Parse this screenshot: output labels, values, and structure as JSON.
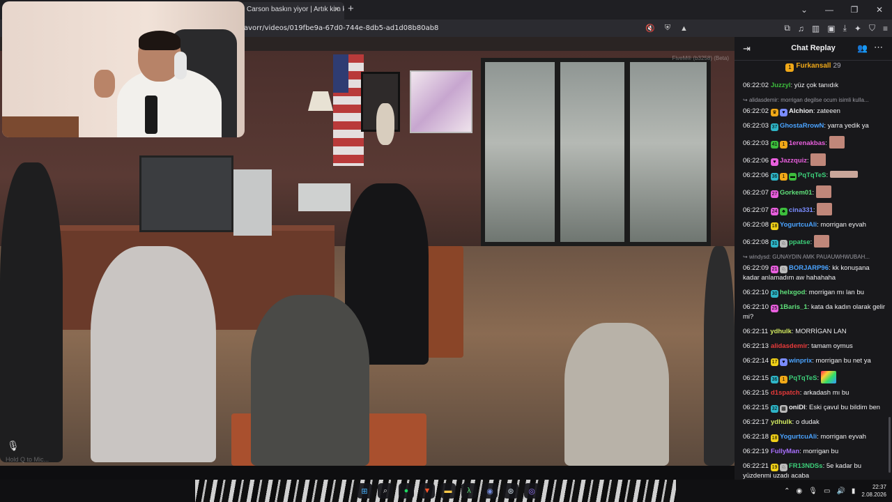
{
  "browser": {
    "tab_title": "Carson baskın yiyor | Artık kim kimi y",
    "url": "avorr/videos/019fbe9a-67d0-744e-8db5-ad1d08b80ab8",
    "icons": [
      "extensions-icon",
      "music-icon",
      "sidebar-icon",
      "wallet-icon",
      "download-icon",
      "ai-icon",
      "vpn-icon",
      "menu-icon"
    ]
  },
  "video": {
    "overlay_tag": "FiveM® (b3258) (Beta)",
    "bottom_hint": "Hold Q to Mic...",
    "webcam": true
  },
  "chat": {
    "title": "Chat Replay",
    "pinned_name": "Furkansall",
    "pinned_count": "29",
    "messages": [
      {
        "ts": "06:22:02",
        "name": "Juzzyl",
        "color": "#3dbd3d",
        "text": "yüz çok tanıdık",
        "badges": []
      },
      {
        "ts": "06:22:02",
        "name": "Alchion",
        "color": "#efeff1",
        "text": "zateeen",
        "reply": "alidasdemir: morrigan degilse ocum isimli kulla...",
        "badges": [
          {
            "c": "#f0a818",
            "t": "♛"
          },
          {
            "c": "#7a8cff",
            "t": "♥"
          }
        ]
      },
      {
        "ts": "06:22:03",
        "name": "GhostaRrowN",
        "color": "#4aa3ff",
        "text": "yarra yedik ya",
        "badges": [
          {
            "c": "#2fb5c7",
            "t": "37"
          }
        ]
      },
      {
        "ts": "06:22:03",
        "name": "1erenakbas",
        "color": "#e85fdd",
        "text": "",
        "emote": "face",
        "badges": [
          {
            "c": "#3dbd3d",
            "t": "41"
          },
          {
            "c": "#f0a818",
            "t": "1"
          }
        ]
      },
      {
        "ts": "06:22:06",
        "name": "Jazzquiz",
        "color": "#e85fdd",
        "text": "",
        "emote": "face",
        "badges": [
          {
            "c": "#e85fdd",
            "t": "♥"
          }
        ]
      },
      {
        "ts": "06:22:06",
        "name": "PqTqTeS",
        "color": "#3dd07a",
        "text": "",
        "emote": "wide",
        "badges": [
          {
            "c": "#2fb5c7",
            "t": "36"
          },
          {
            "c": "#f0a818",
            "t": "1"
          },
          {
            "c": "#3dbd3d",
            "t": "▬"
          }
        ]
      },
      {
        "ts": "06:22:07",
        "name": "Gorkem01",
        "color": "#5fe07a",
        "text": "",
        "emote": "face",
        "badges": [
          {
            "c": "#e85fdd",
            "t": "27"
          }
        ]
      },
      {
        "ts": "06:22:07",
        "name": "cina331",
        "color": "#7a8cff",
        "text": "",
        "emote": "face",
        "badges": [
          {
            "c": "#e85fdd",
            "t": "24"
          },
          {
            "c": "#3dbd3d",
            "t": "♣"
          }
        ]
      },
      {
        "ts": "06:22:08",
        "name": "YogurtcuAli",
        "color": "#4aa3ff",
        "text": "morrigan eyvah",
        "badges": [
          {
            "c": "#f0d018",
            "t": "18"
          }
        ]
      },
      {
        "ts": "06:22:08",
        "name": "ppatse",
        "color": "#3dd07a",
        "text": "",
        "emote": "face",
        "badges": [
          {
            "c": "#2fb5c7",
            "t": "31"
          },
          {
            "c": "#bbbbbb",
            "t": "♘"
          }
        ]
      },
      {
        "ts": "06:22:09",
        "name": "BORJARP96",
        "color": "#4aa3ff",
        "text": "kk konuşana kadar anlamadım aw hahahaha",
        "reply": "windysd: GUNAYDIN AMK PAUAUWHWUBAH...",
        "badges": [
          {
            "c": "#e85fdd",
            "t": "21"
          },
          {
            "c": "#bbbbbb",
            "t": "♘"
          }
        ]
      },
      {
        "ts": "06:22:10",
        "name": "helxgod",
        "color": "#5fe07a",
        "text": "morrigan mı lan bu",
        "badges": [
          {
            "c": "#2fb5c7",
            "t": "30"
          }
        ]
      },
      {
        "ts": "06:22:10",
        "name": "1Baris_1",
        "color": "#5fe07a",
        "text": "kata da kadın olarak gelir mi?",
        "badges": [
          {
            "c": "#e85fdd",
            "t": "25"
          }
        ]
      },
      {
        "ts": "06:22:11",
        "name": "ydhulk",
        "color": "#d0e85f",
        "text": "MORRİGAN LAN",
        "badges": []
      },
      {
        "ts": "06:22:13",
        "name": "alidasdemir",
        "color": "#e83a3a",
        "text": "tamam oymus",
        "badges": []
      },
      {
        "ts": "06:22:14",
        "name": "winprix",
        "color": "#4aa3ff",
        "text": "morrigan bu net ya",
        "badges": [
          {
            "c": "#f0d018",
            "t": "17"
          },
          {
            "c": "#7a8cff",
            "t": "♥"
          }
        ]
      },
      {
        "ts": "06:22:15",
        "name": "PqTqTeS",
        "color": "#3dd07a",
        "text": "",
        "emote": "rainbow",
        "badges": [
          {
            "c": "#2fb5c7",
            "t": "36"
          },
          {
            "c": "#f0a818",
            "t": "1"
          }
        ]
      },
      {
        "ts": "06:22:15",
        "name": "d1spatch",
        "color": "#e83a3a",
        "text": "arkadash mı bu",
        "badges": []
      },
      {
        "ts": "06:22:15",
        "name": "oniDl",
        "color": "#efeff1",
        "text": "Eski çavul bu bildim ben",
        "badges": [
          {
            "c": "#2fb5c7",
            "t": "32"
          },
          {
            "c": "#bbbbbb",
            "t": "▩"
          }
        ]
      },
      {
        "ts": "06:22:17",
        "name": "ydhulk",
        "color": "#d0e85f",
        "text": "o dudak",
        "badges": []
      },
      {
        "ts": "06:22:18",
        "name": "YogurtcuAli",
        "color": "#4aa3ff",
        "text": "morrigan eyvah",
        "badges": [
          {
            "c": "#f0d018",
            "t": "18"
          }
        ]
      },
      {
        "ts": "06:22:19",
        "name": "FullyMan",
        "color": "#a970ff",
        "text": "morrigan bu",
        "badges": []
      },
      {
        "ts": "06:22:21",
        "name": "FR13NDSs",
        "color": "#3dd07a",
        "text": "5e kadar bu yüzdenmi uzadı acaba",
        "badges": [
          {
            "c": "#f0d018",
            "t": "19"
          },
          {
            "c": "#bbbbbb",
            "t": "♘"
          }
        ]
      }
    ]
  },
  "taskbar": {
    "apps": [
      "windows-start-icon",
      "search-icon",
      "spotify-icon",
      "brave-icon",
      "files-icon",
      "terminal-icon",
      "discord-icon",
      "steam-icon",
      "app-icon"
    ],
    "time": "22:37",
    "date": "2.08.2026"
  }
}
